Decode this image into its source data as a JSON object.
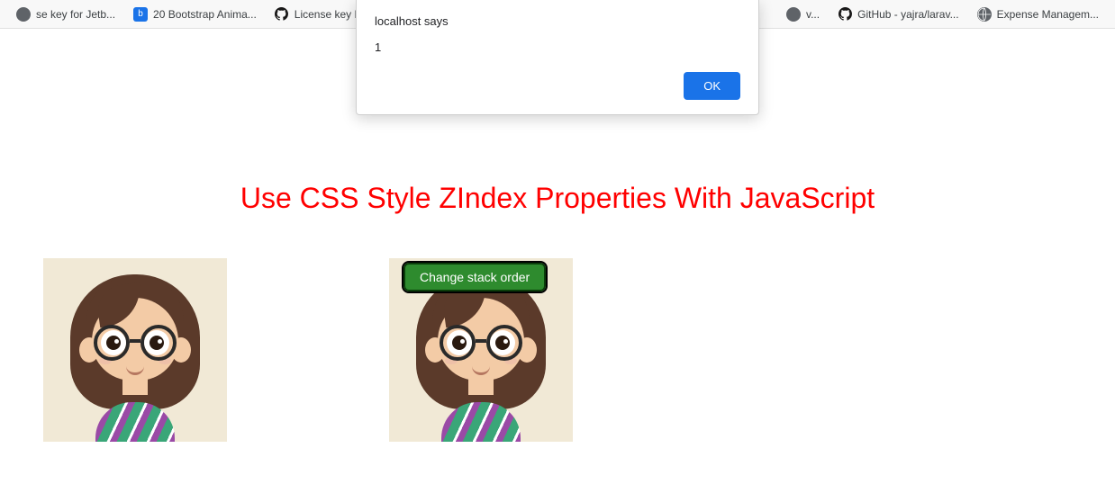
{
  "bookmarks": [
    {
      "label": "se key for Jetb...",
      "icon": "generic"
    },
    {
      "label": "20 Bootstrap Anima...",
      "icon": "blue"
    },
    {
      "label": "License key PhpStor...",
      "icon": "github"
    },
    {
      "label": "v...",
      "icon": "generic",
      "align": "right"
    },
    {
      "label": "GitHub - yajra/larav...",
      "icon": "github",
      "align": "right"
    },
    {
      "label": "Expense Managem...",
      "icon": "globe",
      "align": "right"
    }
  ],
  "alert": {
    "title": "localhost says",
    "message": "1",
    "ok_label": "OK"
  },
  "page": {
    "heading": "Use CSS Style ZIndex Properties With JavaScript",
    "button_label": "Change stack order"
  }
}
